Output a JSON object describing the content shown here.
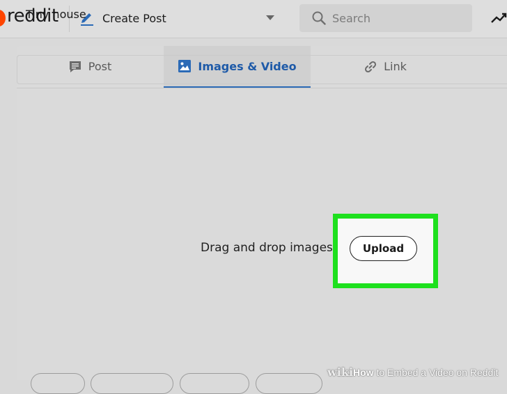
{
  "header": {
    "logo_text": "reddit",
    "create_post_label": "Create Post",
    "search_placeholder": "Search"
  },
  "tabs": [
    {
      "label": "Post",
      "icon": "post-icon",
      "active": false
    },
    {
      "label": "Images & Video",
      "icon": "image-icon",
      "active": true
    },
    {
      "label": "Link",
      "icon": "link-icon",
      "active": false
    }
  ],
  "post": {
    "title_value": "Tiny house",
    "drop_text": "Drag and drop images or",
    "upload_label": "Upload"
  },
  "watermark": {
    "prefix": "wiki",
    "how": "How",
    "rest": " to Embed a Video on Reddit"
  },
  "colors": {
    "accent_blue": "#2b6ab6",
    "highlight_green": "#1ee01e",
    "reddit_orange": "#ff4500"
  }
}
